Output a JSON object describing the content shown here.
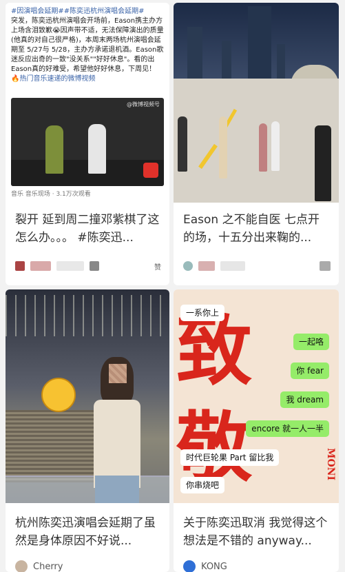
{
  "cards": [
    {
      "title": "裂开 延到周二撞邓紫棋了这怎么办。。。 #陈奕迅...",
      "weibo": {
        "tags": "#因演唱会延期##陈奕迅杭州演唱会延期#",
        "body": "突发，陈奕迅杭州演唱会开场前，Eason携主办方上场含泪致歉😭因声带不适，无法保障演出的质量(他真的对自己很严格)，本周末两场杭州演唱会延期至 5/27与 5/28，主办方承诺退机酒。Eason歌迷反应出奇的一致\"没关系\"\"好好休息\"。看的出Eason真的好难受，希望他好好休息，下周见！",
        "link": "🔥热门音乐速递的微博视频",
        "watermark": "@微博视频号",
        "video_meta": "音乐 音乐现场 · 3.1万次观看"
      },
      "likes": "赞"
    },
    {
      "title": "Eason 之不能自医 七点开的场，十五分出来鞠的..."
    },
    {
      "title": "杭州陈奕迅演唱会延期了虽然是身体原因不好说...",
      "author": "Cherry"
    },
    {
      "title": "关于陈奕迅取消 我觉得这个想法是不错的 anyway...",
      "author": "KONG",
      "bubbles": [
        {
          "text": "一系你上",
          "style": "white"
        },
        {
          "text": "一起咯",
          "style": "green"
        },
        {
          "text": "你 fear",
          "style": "green"
        },
        {
          "text": "我 dream",
          "style": "green"
        },
        {
          "text": "encore 就一人一半",
          "style": "green"
        },
        {
          "text": "时代巨轮果 Part 留比我",
          "style": "white"
        },
        {
          "text": "你串烧吧",
          "style": "white"
        }
      ],
      "poster_chars": "致敬",
      "poster_side": "MONI"
    }
  ],
  "colors": {
    "accent_red": "#d9261c",
    "wechat_green": "#95ec69",
    "link_blue": "#3a63a8"
  }
}
